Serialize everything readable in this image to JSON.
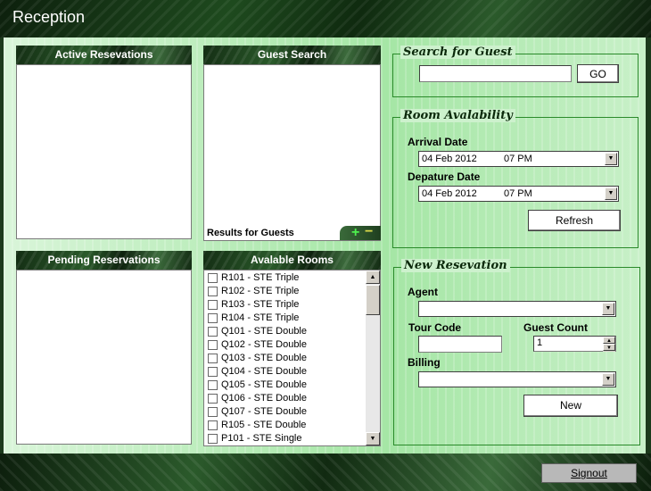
{
  "window": {
    "title": "Reception"
  },
  "panels": {
    "active": {
      "title": "Active Resevations"
    },
    "guest_search": {
      "title": "Guest Search",
      "results_label": "Results for Guests"
    },
    "pending": {
      "title": "Pending Reservations"
    },
    "available": {
      "title": "Avalable Rooms",
      "rooms": [
        "R101 - STE Triple",
        "R102 - STE Triple",
        "R103 - STE Triple",
        "R104 - STE Triple",
        "Q101 - STE Double",
        "Q102 - STE Double",
        "Q103 - STE Double",
        "Q104 - STE Double",
        "Q105 - STE Double",
        "Q106 - STE Double",
        "Q107 - STE Double",
        "R105 - STE Double",
        "P101 - STE Single"
      ]
    }
  },
  "search": {
    "legend": "Search for Guest",
    "value": "",
    "go_label": "GO"
  },
  "availability": {
    "legend": "Room Avalability",
    "arrival_label": "Arrival Date",
    "arrival_date": "04 Feb 2012",
    "arrival_time": "07 PM",
    "departure_label": "Depature Date",
    "departure_date": "04 Feb 2012",
    "departure_time": "07 PM",
    "refresh_label": "Refresh"
  },
  "new_reservation": {
    "legend": "New Resevation",
    "agent_label": "Agent",
    "agent_value": "",
    "tour_code_label": "Tour Code",
    "tour_code_value": "",
    "guest_count_label": "Guest Count",
    "guest_count_value": "1",
    "billing_label": "Billing",
    "billing_value": "",
    "new_label": "New"
  },
  "footer": {
    "signout_label": "Signout"
  }
}
